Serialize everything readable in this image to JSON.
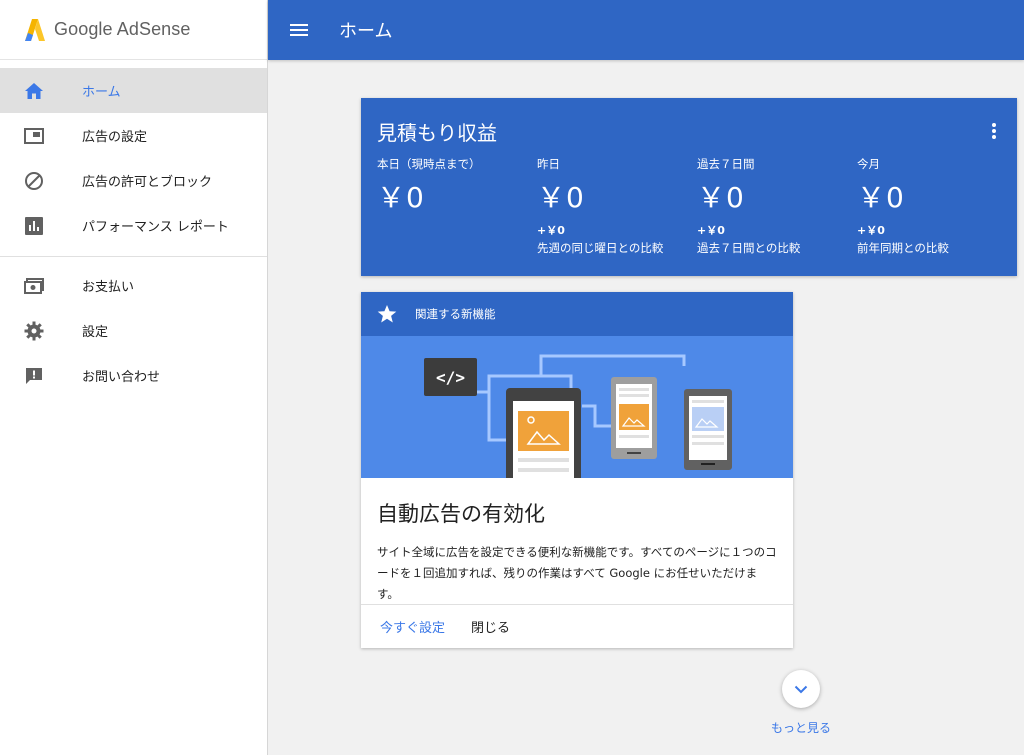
{
  "app": {
    "brand": "Google AdSense"
  },
  "header": {
    "title": "ホーム"
  },
  "sidebar": {
    "items": [
      {
        "label": "ホーム",
        "icon": "home-icon",
        "active": true
      },
      {
        "label": "広告の設定",
        "icon": "ads-icon"
      },
      {
        "label": "広告の許可とブロック",
        "icon": "block-icon"
      },
      {
        "label": "パフォーマンス レポート",
        "icon": "bar-chart-icon"
      },
      {
        "label": "お支払い",
        "icon": "payments-icon"
      },
      {
        "label": "設定",
        "icon": "gear-icon"
      },
      {
        "label": "お問い合わせ",
        "icon": "feedback-icon"
      }
    ]
  },
  "earnings": {
    "title": "見積もり収益",
    "metrics": [
      {
        "label": "本日（現時点まで）",
        "value": "￥0",
        "delta": "",
        "compare": ""
      },
      {
        "label": "昨日",
        "value": "￥0",
        "delta": "+￥0",
        "compare": "先週の同じ曜日との比較"
      },
      {
        "label": "過去７日間",
        "value": "￥0",
        "delta": "+￥0",
        "compare": "過去７日間との比較"
      },
      {
        "label": "今月",
        "value": "￥0",
        "delta": "+￥0",
        "compare": "前年同期との比較"
      }
    ]
  },
  "feature": {
    "header": "関連する新機能",
    "code_glyph": "</>",
    "title": "自動広告の有効化",
    "description": "サイト全域に広告を設定できる便利な新機能です。すべてのページに１つのコードを１回追加すれば、残りの作業はすべて Google にお任せいただけます。",
    "primary_action": "今すぐ設定",
    "secondary_action": "閉じる"
  },
  "more": {
    "label": "もっと見る"
  },
  "colors": {
    "brand_blue": "#2f66c4",
    "accent_blue": "#3b78e7",
    "illustration_blue": "#4e89e8",
    "ad_orange": "#f0a23a"
  }
}
